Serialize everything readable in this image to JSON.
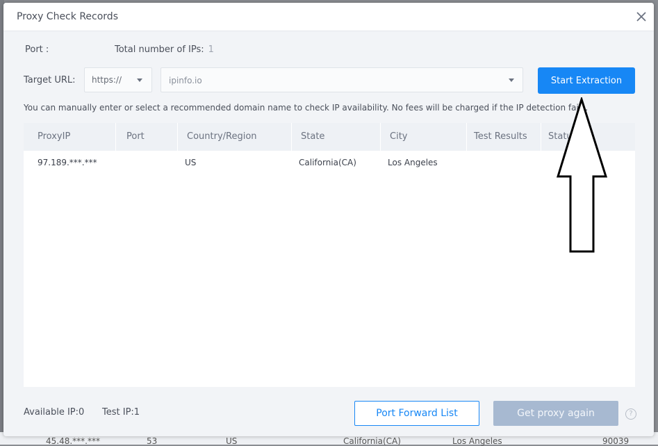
{
  "dialog": {
    "title": "Proxy Check Records",
    "port_label": "Port :",
    "total_ips_label": "Total number of IPs:",
    "total_ips_value": "1",
    "target_url_label": "Target URL:",
    "protocol_value": "https://",
    "url_value": "ipinfo.io",
    "start_button": "Start Extraction",
    "hint": "You can manually enter or select a recommended domain name to check IP availability. No fees will be charged if the IP detection fails."
  },
  "table": {
    "headers": [
      "ProxyIP",
      "Port",
      "Country/Region",
      "State",
      "City",
      "Test Results",
      "Status"
    ],
    "rows": [
      {
        "proxy_ip": "97.189.***.***",
        "port": "",
        "country": "US",
        "state": "California(CA)",
        "city": "Los Angeles",
        "test_results": "",
        "status": ""
      }
    ]
  },
  "footer": {
    "available_ip": "Available IP:0",
    "test_ip": "Test IP:1",
    "port_forward_button": "Port Forward List",
    "get_proxy_button": "Get proxy again",
    "help_glyph": "?"
  },
  "background_row": {
    "ip": "45.48.***.***",
    "port": "53",
    "country": "US",
    "state": "California(CA)",
    "city": "Los Angeles",
    "zip": "90039"
  },
  "colors": {
    "accent": "#1787f5",
    "disabled": "#a7b9d1"
  }
}
